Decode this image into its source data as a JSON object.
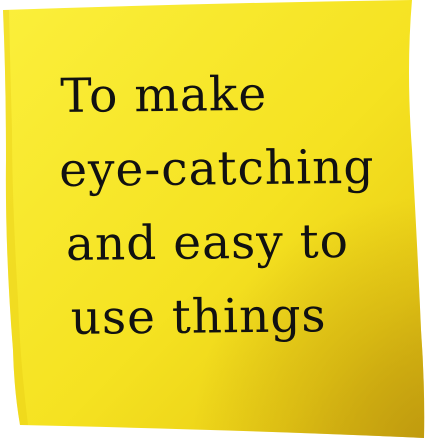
{
  "sticky_note": {
    "lines": [
      "To make",
      "eye-catching",
      "and easy to",
      "use things"
    ],
    "colors": {
      "paper_light": "#f7ea2a",
      "paper_mid": "#f1db14",
      "paper_shadow": "#d9b612",
      "ink": "#111111",
      "background": "#ffffff"
    }
  }
}
